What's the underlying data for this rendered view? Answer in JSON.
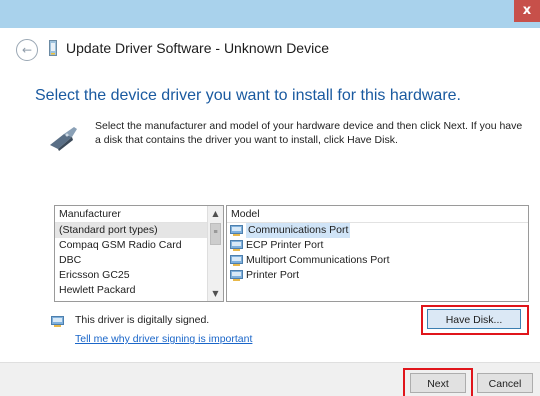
{
  "window": {
    "close_glyph": "x",
    "back_glyph": "←",
    "title": "Update Driver Software - Unknown Device"
  },
  "heading": "Select the device driver you want to install for this hardware.",
  "instruction": "Select the manufacturer and model of your hardware device and then click Next. If you have a disk that contains the driver you want to install, click Have Disk.",
  "manufacturer_list": {
    "header": "Manufacturer",
    "items": [
      "(Standard port types)",
      "Compaq GSM Radio Card",
      "DBC",
      "Ericsson GC25",
      "Hewlett Packard"
    ],
    "selected_index": 0,
    "scroll_up": "▲",
    "scroll_down": "▼",
    "thumb_grip": "≡"
  },
  "model_list": {
    "header": "Model",
    "items": [
      "Communications Port",
      "ECP Printer Port",
      "Multiport Communications Port",
      "Printer Port"
    ],
    "selected_index": 0
  },
  "signature": {
    "text": "This driver is digitally signed.",
    "link": "Tell me why driver signing is important"
  },
  "buttons": {
    "have_disk": "Have Disk...",
    "next": "Next",
    "cancel": "Cancel"
  },
  "colors": {
    "titlebar": "#a9d2ec",
    "heading": "#1a5aa0",
    "link": "#1a66c9",
    "highlight": "#e0151b",
    "close_button": "#c7504a"
  },
  "icons": {
    "back": "back-arrow-icon",
    "device": "device-icon",
    "hardware": "hardware-icon",
    "port": "port-icon",
    "signed": "signed-driver-icon"
  }
}
